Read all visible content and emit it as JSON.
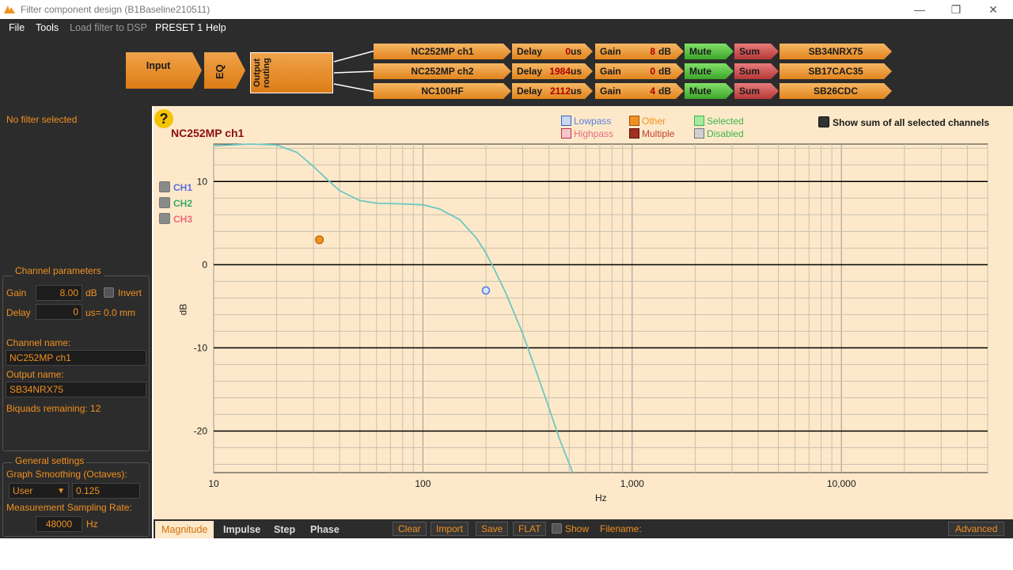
{
  "window": {
    "title": "Filter component design (B1Baseline210511)",
    "minimize": "—",
    "maximize": "❐",
    "close": "✕"
  },
  "menu": [
    "File",
    "Tools",
    "Load filter to DSP",
    "PRESET 1",
    "Help"
  ],
  "pipeline": {
    "input": "Input",
    "eq": "EQ",
    "routing": "Output routing",
    "channels": [
      {
        "name": "NC252MP ch1",
        "delay_label": "Delay",
        "delay": "0",
        "delay_unit": "us",
        "gain_label": "Gain",
        "gain": "8",
        "gain_unit": "dB",
        "mute": "Mute",
        "sum": "Sum",
        "output": "SB34NRX75"
      },
      {
        "name": "NC252MP ch2",
        "delay_label": "Delay",
        "delay": "1984",
        "delay_unit": "us",
        "gain_label": "Gain",
        "gain": "0",
        "gain_unit": "dB",
        "mute": "Mute",
        "sum": "Sum",
        "output": "SB17CAC35"
      },
      {
        "name": "NC100HF",
        "delay_label": "Delay",
        "delay": "2112",
        "delay_unit": "us",
        "gain_label": "Gain",
        "gain": "4",
        "gain_unit": "dB",
        "mute": "Mute",
        "sum": "Sum",
        "output": "SB26CDC"
      }
    ]
  },
  "left": {
    "no_filter": "No filter selected",
    "channel_params_title": "Channel parameters",
    "gain_label": "Gain",
    "gain_value": "8.00",
    "gain_unit": "dB",
    "invert_label": "Invert",
    "delay_label": "Delay",
    "delay_value": "0",
    "delay_unit": "us= 0.0 mm",
    "channel_name_label": "Channel name:",
    "channel_name": "NC252MP ch1",
    "output_name_label": "Output name:",
    "output_name": "SB34NRX75",
    "biquads": "Biquads remaining: 12",
    "general_title": "General settings",
    "smoothing_label": "Graph Smoothing (Octaves):",
    "smoothing_mode": "User",
    "smoothing_value": "0.125",
    "sampling_label": "Measurement Sampling Rate:",
    "sampling_value": "48000",
    "sampling_unit": "Hz"
  },
  "graph": {
    "help": "?",
    "channel_title": "NC252MP ch1",
    "legend": {
      "lowpass": "Lowpass",
      "highpass": "Highpass",
      "other": "Other",
      "multiple": "Multiple",
      "selected": "Selected",
      "disabled": "Disabled",
      "colors": {
        "lowpass": "#5b7ee0",
        "highpass": "#e76c7c",
        "other": "#f09020",
        "multiple": "#a03020",
        "selected": "#3cb54a",
        "disabled": "#888888"
      }
    },
    "show_sum": "Show sum of all selected channels",
    "channels": [
      {
        "label": "CH1",
        "color": "#5b6ee0"
      },
      {
        "label": "CH2",
        "color": "#3ca86a"
      },
      {
        "label": "CH3",
        "color": "#e76c7c"
      }
    ],
    "xlabel": "Hz",
    "ylabel": "dB"
  },
  "chart_data": {
    "type": "line",
    "x_scale": "log",
    "xlim": [
      10,
      50000
    ],
    "ylim": [
      -25,
      14.5
    ],
    "x_ticks": [
      10,
      100,
      1000,
      10000
    ],
    "x_tick_labels": [
      "10",
      "100",
      "1,000",
      "10,000"
    ],
    "y_ticks": [
      10,
      0,
      -10,
      -20
    ],
    "y_tick_labels": [
      "10",
      "0",
      "-10",
      "-20"
    ],
    "xlabel": "Hz",
    "ylabel": "dB",
    "grid": true,
    "series": [
      {
        "color": "#6ec7c4",
        "x": [
          10,
          15,
          20,
          25,
          30,
          35,
          40,
          50,
          60,
          80,
          100,
          120,
          150,
          180,
          200,
          220,
          250,
          300,
          350,
          400,
          450,
          520
        ],
        "y": [
          14.3,
          14.5,
          14.4,
          13.5,
          11.8,
          10.2,
          8.9,
          7.7,
          7.4,
          7.3,
          7.2,
          6.7,
          5.4,
          3.2,
          1.4,
          -0.6,
          -3.5,
          -8.3,
          -13.0,
          -17.2,
          -21.0,
          -25
        ]
      }
    ],
    "markers": [
      {
        "x": 32,
        "y": 3.0,
        "kind": "other"
      },
      {
        "x": 200,
        "y": -3.1,
        "kind": "lowpass"
      }
    ]
  },
  "bottom": {
    "tabs": [
      "Magnitude",
      "Impulse",
      "Step",
      "Phase"
    ],
    "clear": "Clear",
    "import": "Import",
    "save": "Save",
    "flat": "FLAT",
    "show": "Show",
    "filename": "Filename:",
    "advanced": "Advanced"
  }
}
